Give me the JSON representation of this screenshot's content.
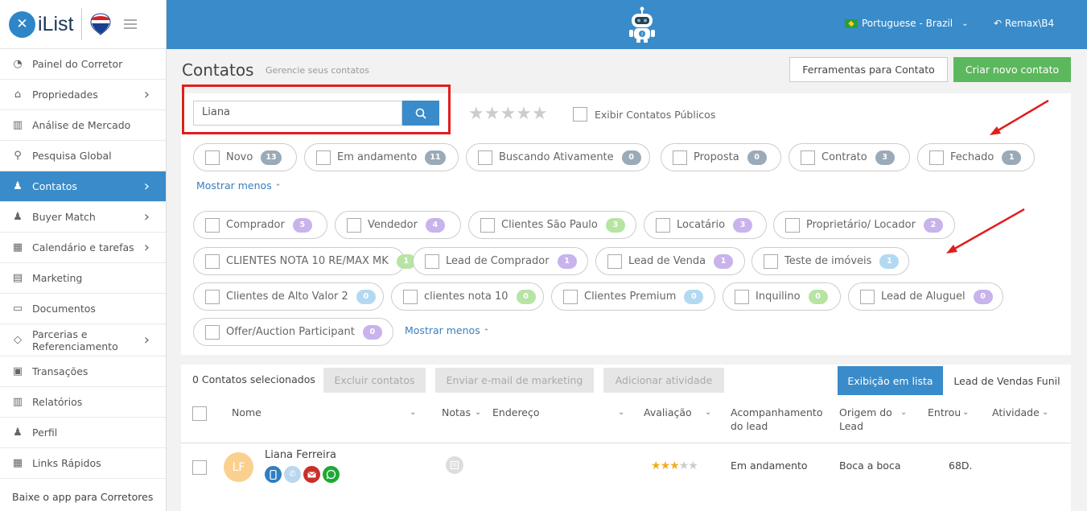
{
  "app": {
    "logo_text": "iList",
    "logo_mark": "✕",
    "remax_text": "RE/MAX"
  },
  "sidebar": {
    "items": [
      {
        "label": "Painel do Corretor",
        "icon": "gauge-icon",
        "chev": false
      },
      {
        "label": "Propriedades",
        "icon": "home-icon",
        "chev": true
      },
      {
        "label": "Análise de Mercado",
        "icon": "bar-chart-icon",
        "chev": false
      },
      {
        "label": "Pesquisa Global",
        "icon": "search-icon",
        "chev": false
      },
      {
        "label": "Contatos",
        "icon": "contacts-icon",
        "chev": true,
        "active": true
      },
      {
        "label": "Buyer Match",
        "icon": "user-icon",
        "chev": true
      },
      {
        "label": "Calendário e tarefas",
        "icon": "calendar-icon",
        "chev": true
      },
      {
        "label": "Marketing",
        "icon": "book-icon",
        "chev": false
      },
      {
        "label": "Documentos",
        "icon": "folder-icon",
        "chev": false
      },
      {
        "label": "Parcerias e Referenciamento",
        "icon": "handshake-icon",
        "chev": true
      },
      {
        "label": "Transações",
        "icon": "briefcase-icon",
        "chev": false
      },
      {
        "label": "Relatórios",
        "icon": "report-icon",
        "chev": false
      },
      {
        "label": "Perfil",
        "icon": "profile-icon",
        "chev": false
      },
      {
        "label": "Links Rápidos",
        "icon": "link-icon",
        "chev": false
      }
    ],
    "app_download": "Baixe o app para Corretores"
  },
  "topbar": {
    "language": "Portuguese - Brazil",
    "user": "Remax\\B4"
  },
  "page": {
    "title": "Contatos",
    "subtitle": "Gerencie seus contatos"
  },
  "buttons": {
    "tools": "Ferramentas para Contato",
    "new_contact": "Criar novo contato"
  },
  "search": {
    "value": "Liana"
  },
  "public_contacts_label": "Exibir Contatos Públicos",
  "stars_glyphs": "★★★★★",
  "status_filters": [
    {
      "label": "Novo",
      "count": "13"
    },
    {
      "label": "Em andamento",
      "count": "11"
    },
    {
      "label": "Buscando Ativamente",
      "count": "0"
    },
    {
      "label": "Proposta",
      "count": "0"
    },
    {
      "label": "Contrato",
      "count": "3"
    },
    {
      "label": "Fechado",
      "count": "1"
    }
  ],
  "show_less": "Mostrar menos",
  "tag_filters": [
    {
      "label": "Comprador",
      "count": "5",
      "color": "purple"
    },
    {
      "label": "Vendedor",
      "count": "4",
      "color": "purple"
    },
    {
      "label": "Clientes São Paulo",
      "count": "3",
      "color": "green"
    },
    {
      "label": "Locatário",
      "count": "3",
      "color": "purple"
    },
    {
      "label": "Proprietário/ Locador",
      "count": "2",
      "color": "purple"
    },
    {
      "label": "CLIENTES NOTA 10 RE/MAX MK",
      "count": "1",
      "color": "green"
    },
    {
      "label": "Lead de Comprador",
      "count": "1",
      "color": "purple"
    },
    {
      "label": "Lead de Venda",
      "count": "1",
      "color": "purple"
    },
    {
      "label": "Teste de imóveis",
      "count": "1",
      "color": "blue"
    },
    {
      "label": "Clientes de Alto Valor 2",
      "count": "0",
      "color": "blue"
    },
    {
      "label": "clientes nota 10",
      "count": "0",
      "color": "green"
    },
    {
      "label": "Clientes Premium",
      "count": "0",
      "color": "blue"
    },
    {
      "label": "Inquilino",
      "count": "0",
      "color": "green"
    },
    {
      "label": "Lead de Aluguel",
      "count": "0",
      "color": "purple"
    },
    {
      "label": "Offer/Auction Participant",
      "count": "0",
      "color": "purple"
    }
  ],
  "list": {
    "selected": "0 Contatos selecionados",
    "delete": "Excluir contatos",
    "email": "Enviar e-mail de marketing",
    "activity": "Adicionar atividade",
    "view_list": "Exibição em lista",
    "view_funnel": "Lead de Vendas Funil",
    "columns": {
      "name": "Nome",
      "notes": "Notas",
      "address": "Endereço",
      "rating": "Avaliação",
      "followup_1": "Acompanhamento",
      "followup_2": "do lead",
      "origin_1": "Origem do",
      "origin_2": "Lead",
      "entered": "Entrou",
      "activity": "Atividade"
    },
    "rows": [
      {
        "initials": "LF",
        "name": "Liana Ferreira",
        "stars": "★★★★★",
        "rating": 3,
        "followup": "Em andamento",
        "origin": "Boca a boca",
        "entered": "68D."
      }
    ]
  },
  "colors": {
    "primary": "#3a8bc9",
    "success": "#5cb85c",
    "highlight": "#e21d1d"
  }
}
